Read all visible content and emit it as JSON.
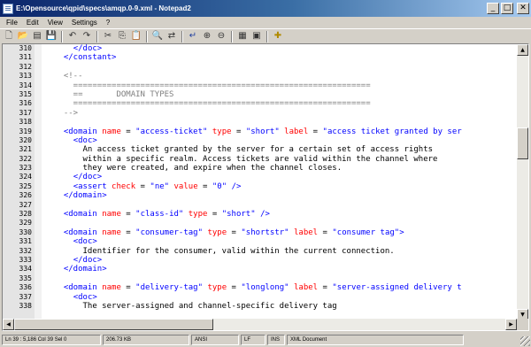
{
  "window": {
    "title": "E:\\Opensource\\qpid\\specs\\amqp.0-9.xml - Notepad2",
    "minimize_glyph": "_",
    "maximize_glyph": "□",
    "close_glyph": "✕"
  },
  "menu": [
    "File",
    "Edit",
    "View",
    "Settings",
    "?"
  ],
  "toolbar": {
    "buttons": [
      {
        "icon": "new-file-icon",
        "glyph": "🗋"
      },
      {
        "icon": "open-folder-icon",
        "glyph": "📂"
      },
      {
        "icon": "browse-icon",
        "glyph": "▤"
      },
      {
        "icon": "save-icon",
        "glyph": "💾"
      },
      {
        "icon": "undo-icon",
        "glyph": "↶"
      },
      {
        "icon": "redo-icon",
        "glyph": "↷"
      },
      {
        "icon": "cut-icon",
        "glyph": "✂"
      },
      {
        "icon": "copy-icon",
        "glyph": "⎘"
      },
      {
        "icon": "paste-icon",
        "glyph": "📋"
      },
      {
        "icon": "find-icon",
        "glyph": "🔍"
      },
      {
        "icon": "replace-icon",
        "glyph": "⇄"
      },
      {
        "icon": "word-wrap-icon",
        "glyph": "↵"
      },
      {
        "icon": "zoom-in-icon",
        "glyph": "⊕"
      },
      {
        "icon": "zoom-out-icon",
        "glyph": "⊖"
      },
      {
        "icon": "scheme-icon",
        "glyph": "▦"
      },
      {
        "icon": "scheme-config-icon",
        "glyph": "▣"
      },
      {
        "icon": "favorites-icon",
        "glyph": "✚"
      }
    ]
  },
  "editor": {
    "lines": [
      {
        "n": "310",
        "parts": [
          {
            "t": "    "
          },
          {
            "c": "tag",
            "t": "</doc>"
          }
        ]
      },
      {
        "n": "311",
        "parts": [
          {
            "t": "  "
          },
          {
            "c": "tag",
            "t": "</constant>"
          }
        ]
      },
      {
        "n": "312",
        "parts": []
      },
      {
        "n": "313",
        "parts": [
          {
            "t": "  "
          },
          {
            "c": "cmt",
            "t": "<!--"
          }
        ]
      },
      {
        "n": "314",
        "parts": [
          {
            "c": "cmt",
            "t": "    =============================================================="
          }
        ]
      },
      {
        "n": "315",
        "parts": [
          {
            "c": "cmt",
            "t": "    ==       DOMAIN TYPES"
          }
        ]
      },
      {
        "n": "316",
        "parts": [
          {
            "c": "cmt",
            "t": "    =============================================================="
          }
        ]
      },
      {
        "n": "317",
        "parts": [
          {
            "c": "cmt",
            "t": "  -->"
          }
        ]
      },
      {
        "n": "318",
        "parts": []
      },
      {
        "n": "319",
        "parts": [
          {
            "t": "  "
          },
          {
            "c": "tag",
            "t": "<domain "
          },
          {
            "c": "attr",
            "t": "name"
          },
          {
            "t": " = "
          },
          {
            "c": "val",
            "t": "\"access-ticket\""
          },
          {
            "t": " "
          },
          {
            "c": "attr",
            "t": "type"
          },
          {
            "t": " = "
          },
          {
            "c": "val",
            "t": "\"short\""
          },
          {
            "t": " "
          },
          {
            "c": "attr",
            "t": "label"
          },
          {
            "t": " = "
          },
          {
            "c": "val",
            "t": "\"access ticket granted by ser"
          }
        ]
      },
      {
        "n": "320",
        "parts": [
          {
            "t": "    "
          },
          {
            "c": "tag",
            "t": "<doc>"
          }
        ]
      },
      {
        "n": "321",
        "parts": [
          {
            "t": "      An access ticket granted by the server for a certain set of access rights"
          }
        ]
      },
      {
        "n": "322",
        "parts": [
          {
            "t": "      within a specific realm. Access tickets are valid within the channel where"
          }
        ]
      },
      {
        "n": "323",
        "parts": [
          {
            "t": "      they were created, and expire when the channel closes."
          }
        ]
      },
      {
        "n": "324",
        "parts": [
          {
            "t": "    "
          },
          {
            "c": "tag",
            "t": "</doc>"
          }
        ]
      },
      {
        "n": "325",
        "parts": [
          {
            "t": "    "
          },
          {
            "c": "tag",
            "t": "<assert "
          },
          {
            "c": "attr",
            "t": "check"
          },
          {
            "t": " = "
          },
          {
            "c": "val",
            "t": "\"ne\""
          },
          {
            "t": " "
          },
          {
            "c": "attr",
            "t": "value"
          },
          {
            "t": " = "
          },
          {
            "c": "val",
            "t": "\"0\""
          },
          {
            "t": " "
          },
          {
            "c": "tag",
            "t": "/>"
          }
        ]
      },
      {
        "n": "326",
        "parts": [
          {
            "t": "  "
          },
          {
            "c": "tag",
            "t": "</domain>"
          }
        ]
      },
      {
        "n": "327",
        "parts": []
      },
      {
        "n": "328",
        "parts": [
          {
            "t": "  "
          },
          {
            "c": "tag",
            "t": "<domain "
          },
          {
            "c": "attr",
            "t": "name"
          },
          {
            "t": " = "
          },
          {
            "c": "val",
            "t": "\"class-id\""
          },
          {
            "t": " "
          },
          {
            "c": "attr",
            "t": "type"
          },
          {
            "t": " = "
          },
          {
            "c": "val",
            "t": "\"short\""
          },
          {
            "t": " "
          },
          {
            "c": "tag",
            "t": "/>"
          }
        ]
      },
      {
        "n": "329",
        "parts": []
      },
      {
        "n": "330",
        "parts": [
          {
            "t": "  "
          },
          {
            "c": "tag",
            "t": "<domain "
          },
          {
            "c": "attr",
            "t": "name"
          },
          {
            "t": " = "
          },
          {
            "c": "val",
            "t": "\"consumer-tag\""
          },
          {
            "t": " "
          },
          {
            "c": "attr",
            "t": "type"
          },
          {
            "t": " = "
          },
          {
            "c": "val",
            "t": "\"shortstr\""
          },
          {
            "t": " "
          },
          {
            "c": "attr",
            "t": "label"
          },
          {
            "t": " = "
          },
          {
            "c": "val",
            "t": "\"consumer tag\""
          },
          {
            "c": "tag",
            "t": ">"
          }
        ]
      },
      {
        "n": "331",
        "parts": [
          {
            "t": "    "
          },
          {
            "c": "tag",
            "t": "<doc>"
          }
        ]
      },
      {
        "n": "332",
        "parts": [
          {
            "t": "      Identifier for the consumer, valid within the current connection."
          }
        ]
      },
      {
        "n": "333",
        "parts": [
          {
            "t": "    "
          },
          {
            "c": "tag",
            "t": "</doc>"
          }
        ]
      },
      {
        "n": "334",
        "parts": [
          {
            "t": "  "
          },
          {
            "c": "tag",
            "t": "</domain>"
          }
        ]
      },
      {
        "n": "335",
        "parts": []
      },
      {
        "n": "336",
        "parts": [
          {
            "t": "  "
          },
          {
            "c": "tag",
            "t": "<domain "
          },
          {
            "c": "attr",
            "t": "name"
          },
          {
            "t": " = "
          },
          {
            "c": "val",
            "t": "\"delivery-tag\""
          },
          {
            "t": " "
          },
          {
            "c": "attr",
            "t": "type"
          },
          {
            "t": " = "
          },
          {
            "c": "val",
            "t": "\"longlong\""
          },
          {
            "t": " "
          },
          {
            "c": "attr",
            "t": "label"
          },
          {
            "t": " = "
          },
          {
            "c": "val",
            "t": "\"server-assigned delivery t"
          }
        ]
      },
      {
        "n": "337",
        "parts": [
          {
            "t": "    "
          },
          {
            "c": "tag",
            "t": "<doc>"
          }
        ]
      },
      {
        "n": "338",
        "parts": [
          {
            "t": "      The server-assigned and channel-specific delivery tag"
          }
        ]
      }
    ]
  },
  "status": {
    "position": "Ln 39 : 5,186   Col 39   Sel 0",
    "size": "206.73 KB",
    "encoding": "ANSI",
    "eol": "LF",
    "mode": "INS",
    "scheme": "XML Document"
  }
}
